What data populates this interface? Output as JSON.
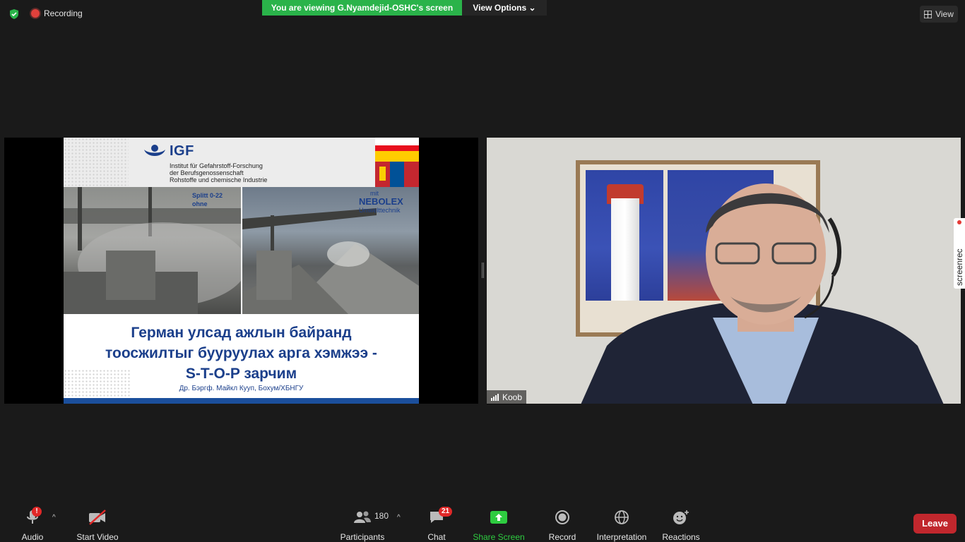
{
  "topbar": {
    "recording_label": "Recording",
    "viewing_banner": "You are viewing G.Nyamdejid-OSHC's screen",
    "view_options_label": "View Options",
    "view_label": "View"
  },
  "slide": {
    "logo_text": "IGF",
    "institute_lines": [
      "Institut für Gefahrstoff-Forschung",
      "der Berufsgenossenschaft",
      "Rohstoffe und chemische Industrie"
    ],
    "splitt_line1": "Splitt 0-22",
    "splitt_line2": "ohne",
    "mit_label": "mit",
    "nebolex_brand": "NEBOLEX",
    "nebolex_sub": "Umwelttechnik",
    "title_line1": "Герман улсад ажлын байранд",
    "title_line2": "тоосжилтыг бууруулах арга хэмжээ -",
    "title_line3": "S-T-O-P зарчим",
    "author": "Др. Бэргф. Майкл Кууп, Бохум/ХБНГУ"
  },
  "video": {
    "participant_name": "Koob",
    "screenrec_label": "screenrec"
  },
  "toolbar": {
    "audio_label": "Audio",
    "start_video_label": "Start Video",
    "participants_label": "Participants",
    "participants_count": "180",
    "chat_label": "Chat",
    "chat_badge": "21",
    "share_screen_label": "Share Screen",
    "record_label": "Record",
    "interpretation_label": "Interpretation",
    "reactions_label": "Reactions",
    "audio_badge": "!",
    "leave_label": "Leave"
  },
  "colors": {
    "share_green": "#2ab34a",
    "leave_red": "#c1272d",
    "slide_blue": "#1b3f8b"
  }
}
